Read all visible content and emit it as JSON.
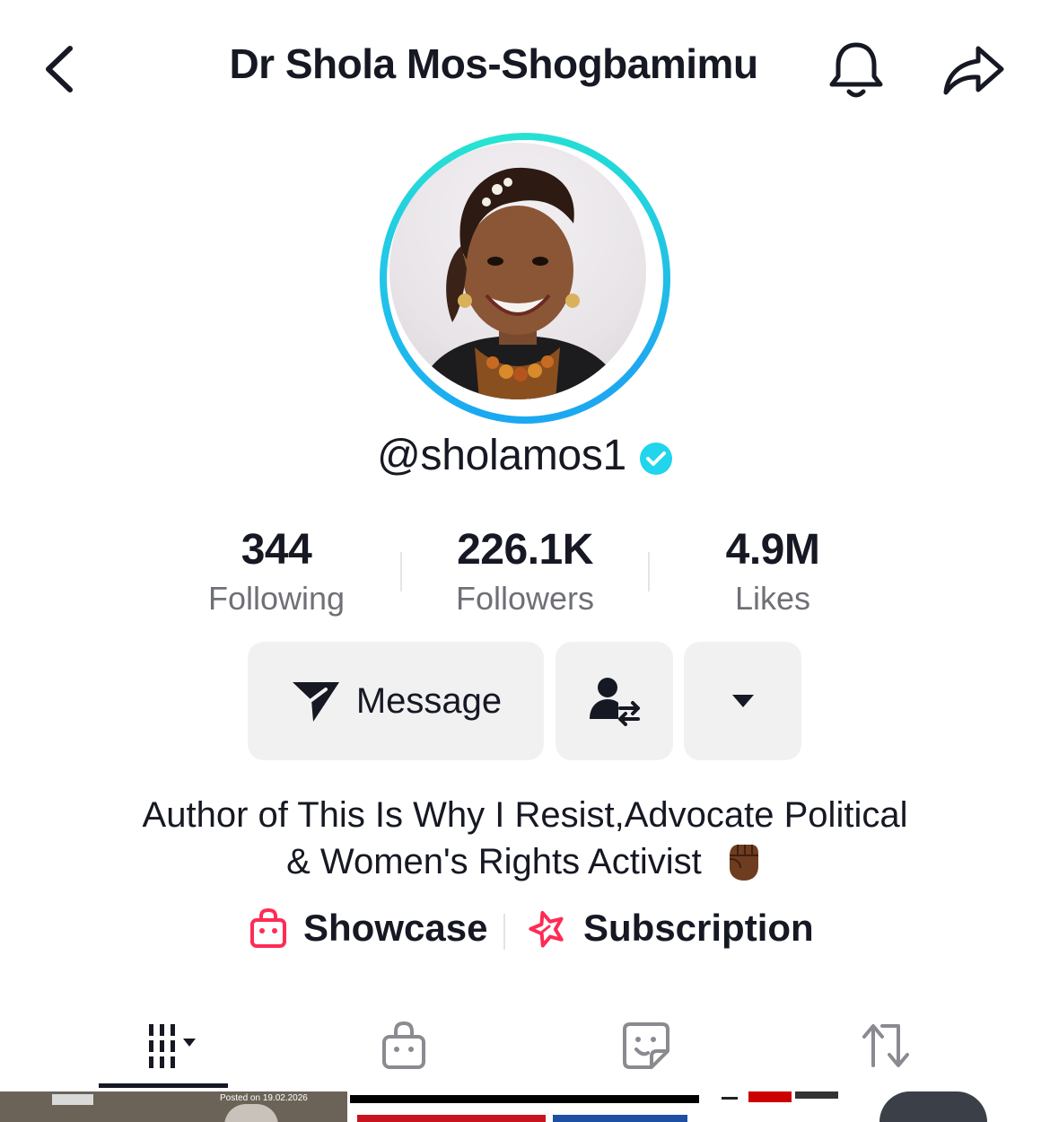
{
  "header": {
    "title": "Dr Shola Mos-Shogbamimu",
    "back_icon": "chevron-left-icon",
    "notification_icon": "bell-icon",
    "share_icon": "share-arrow-icon"
  },
  "profile": {
    "handle": "@sholamos1",
    "verified": true,
    "verified_color": "#20d5ec",
    "ring_colors": [
      "#1aa9f1",
      "#27e4d0"
    ]
  },
  "stats": [
    {
      "value": "344",
      "label": "Following"
    },
    {
      "value": "226.1K",
      "label": "Followers"
    },
    {
      "value": "4.9M",
      "label": "Likes"
    }
  ],
  "actions": {
    "message_label": "Message",
    "message_icon": "send-icon",
    "friend_icon": "person-swap-icon",
    "more_icon": "caret-down-icon"
  },
  "bio": {
    "line1": "Author of This Is Why I Resist,Advocate Political",
    "line2": "& Women's Rights Activist"
  },
  "links": {
    "showcase_label": "Showcase",
    "subscription_label": "Subscription",
    "accent_color": "#fe2c55"
  },
  "tabs": [
    {
      "name": "videos",
      "icon": "grid-icon",
      "active": true
    },
    {
      "name": "shop",
      "icon": "shopping-bag-icon",
      "active": false
    },
    {
      "name": "liked",
      "icon": "sticker-icon",
      "active": false
    },
    {
      "name": "reposts",
      "icon": "repost-icon",
      "active": false
    }
  ],
  "thumbnails": {
    "first_caption": "Posted on 19.02.2026"
  }
}
